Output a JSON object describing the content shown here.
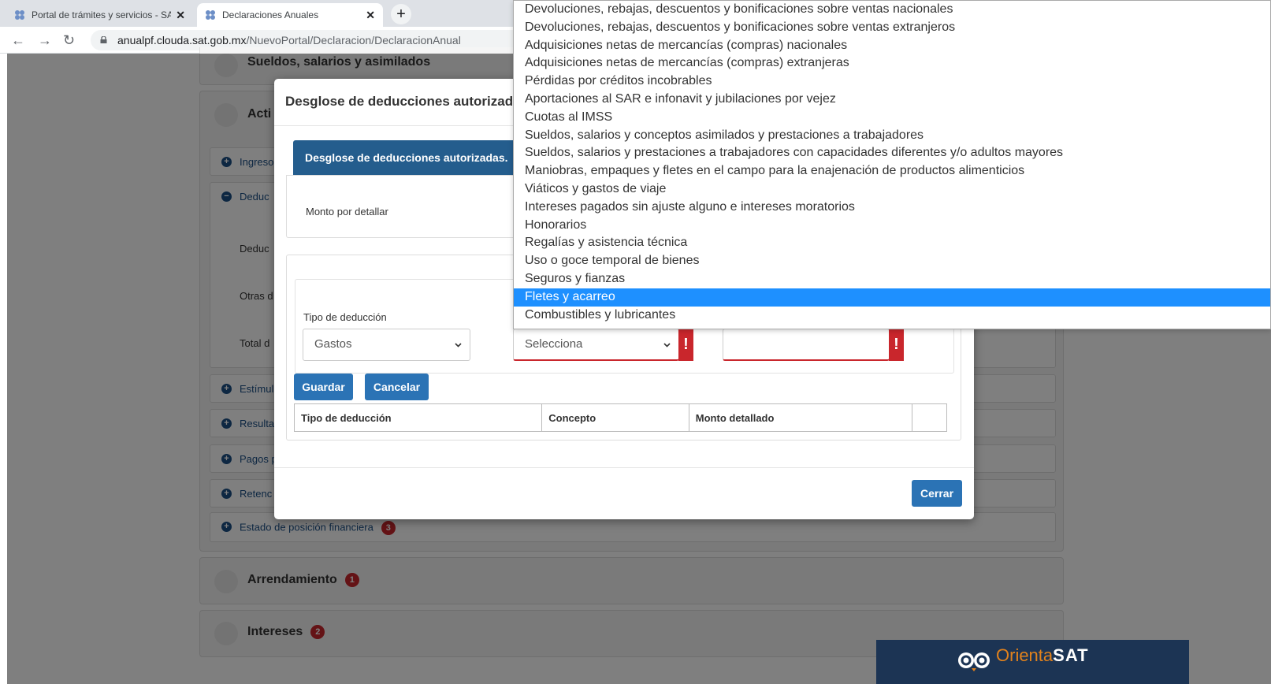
{
  "browser": {
    "tabs": [
      {
        "title": "Portal de trámites y servicios - SAT",
        "active": false
      },
      {
        "title": "Declaraciones Anuales",
        "active": true
      }
    ],
    "new_tab_symbol": "+",
    "url_host": "anualpf.clouda.sat.gob.mx",
    "url_path": "/NuevoPortal/Declaracion/DeclaracionAnual"
  },
  "background": {
    "sections": [
      {
        "title": "Sueldos, salarios y asimilados",
        "icon": "people-icon"
      },
      {
        "title": "Acti",
        "icon": "store-icon"
      },
      {
        "title": "Arrendamiento",
        "icon": "building-icon",
        "badge": "1"
      },
      {
        "title": "Intereses",
        "icon": "growth-icon",
        "badge": "2"
      }
    ],
    "accordion": [
      {
        "label": "Ingreso",
        "state": "collapsed"
      },
      {
        "label": "Deduc",
        "state": "expanded"
      },
      {
        "label": "Estímul",
        "state": "collapsed"
      },
      {
        "label": "Resulta",
        "state": "collapsed"
      },
      {
        "label": "Pagos p",
        "state": "collapsed"
      },
      {
        "label": "Retenc",
        "state": "collapsed"
      },
      {
        "label": "Estado de posición financiera",
        "state": "collapsed",
        "badge": "3"
      }
    ],
    "sublabels": [
      "Deduc",
      "Otras d",
      "Total d"
    ]
  },
  "modal": {
    "title": "Desglose de deducciones autorizadas",
    "panel_header": "Desglose de deducciones autorizadas.",
    "monto_label": "Monto por detallar",
    "tipo_label": "Tipo de deducción",
    "tipo_value": "Gastos",
    "concepto_value": "Selecciona",
    "error_mark": "!",
    "buttons": {
      "guardar": "Guardar",
      "cancelar": "Cancelar",
      "cerrar": "Cerrar"
    },
    "table_headers": [
      "Tipo de deducción",
      "Concepto",
      "Monto detallado",
      ""
    ]
  },
  "dropdown": {
    "selected": "Fletes y acarreo",
    "options": [
      "Devoluciones, rebajas, descuentos y bonificaciones sobre ventas nacionales",
      "Devoluciones, rebajas, descuentos y bonificaciones sobre ventas extranjeros",
      "Adquisiciones netas de mercancías (compras) nacionales",
      "Adquisiciones netas de mercancías (compras) extranjeras",
      "Pérdidas por créditos incobrables",
      "Aportaciones al SAR e infonavit y jubilaciones por vejez",
      "Cuotas al IMSS",
      "Sueldos, salarios y conceptos asimilados y prestaciones a trabajadores",
      "Sueldos, salarios y prestaciones a trabajadores con capacidades diferentes y/o adultos mayores",
      "Maniobras, empaques y fletes en el campo para la enajenación de productos alimenticios",
      "Viáticos y gastos de viaje",
      "Intereses pagados sin ajuste alguno e intereses moratorios",
      "Honorarios",
      "Regalías y asistencia técnica",
      "Uso o goce temporal de bienes",
      "Seguros y fianzas",
      "Fletes y acarreo",
      "Combustibles y lubricantes"
    ]
  },
  "banner": {
    "text_light": "Orienta",
    "text_bold": "SAT"
  },
  "colors": {
    "primary": "#2b73b5",
    "panel_header": "#245d8d",
    "error": "#c9262c",
    "selection": "#1e90ff",
    "banner": "#1c3454"
  }
}
